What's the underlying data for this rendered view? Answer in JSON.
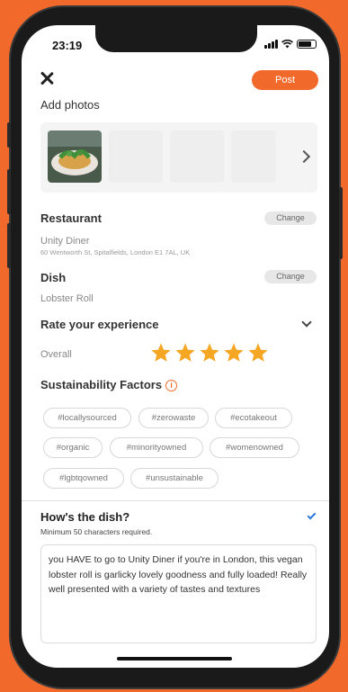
{
  "status": {
    "time": "23:19"
  },
  "header": {
    "post_label": "Post"
  },
  "photos": {
    "title": "Add photos"
  },
  "restaurant": {
    "title": "Restaurant",
    "change_label": "Change",
    "name": "Unity Diner",
    "address": "60 Wentworth St, Spitalfields, London E1 7AL, UK"
  },
  "dish": {
    "title": "Dish",
    "change_label": "Change",
    "name": "Lobster Roll"
  },
  "rating": {
    "title": "Rate your experience",
    "overall_label": "Overall",
    "value": 5,
    "max": 5,
    "star_color": "#f5a623"
  },
  "sustainability": {
    "title": "Sustainability Factors",
    "info_glyph": "i",
    "tags": [
      "#locallysourced",
      "#zerowaste",
      "#ecotakeout",
      "#organic",
      "#minorityowned",
      "#womenowned",
      "#lgbtqowned",
      "#unsustainable"
    ]
  },
  "review": {
    "title": "How's the dish?",
    "hint": "Minimum 50 characters required.",
    "text": "you HAVE to go to Unity Diner if you're in London, this vegan lobster roll is garlicky lovely goodness and fully loaded! Really well presented with a variety of tastes and textures"
  },
  "colors": {
    "accent": "#f26a2b",
    "check": "#2979d9"
  }
}
